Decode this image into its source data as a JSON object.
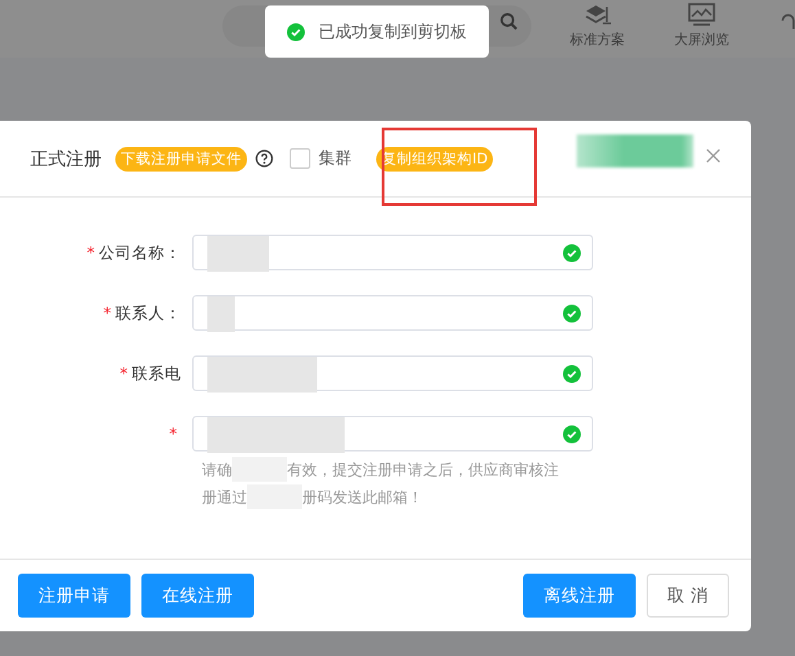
{
  "top_bar": {
    "nav": [
      {
        "label": "标准方案",
        "kind": "layers"
      },
      {
        "label": "大屏浏览",
        "kind": "monitor"
      }
    ]
  },
  "toast": {
    "message": "已成功复制到剪切板"
  },
  "dialog": {
    "title": "正式注册",
    "download_tag": "下载注册申请文件",
    "cluster": {
      "label": "集群",
      "checked": false
    },
    "copy_tag": "复制组织架构ID",
    "fields": [
      {
        "required_mark": "*",
        "label": "公司名称：",
        "valid": true
      },
      {
        "required_mark": "*",
        "label": "联系人：",
        "valid": true
      },
      {
        "required_mark": "*",
        "label": "联系电",
        "valid": true
      },
      {
        "required_mark": "*",
        "valid": true
      }
    ],
    "hint": [
      [
        "请确",
        "有效，提交注册申请之后，供应商审核注"
      ],
      [
        "册通过",
        "册码发送此邮箱！"
      ]
    ],
    "left_buttons": [
      "注册申请",
      "在线注册"
    ],
    "primary_button": "离线注册",
    "cancel_button": "取 消"
  }
}
